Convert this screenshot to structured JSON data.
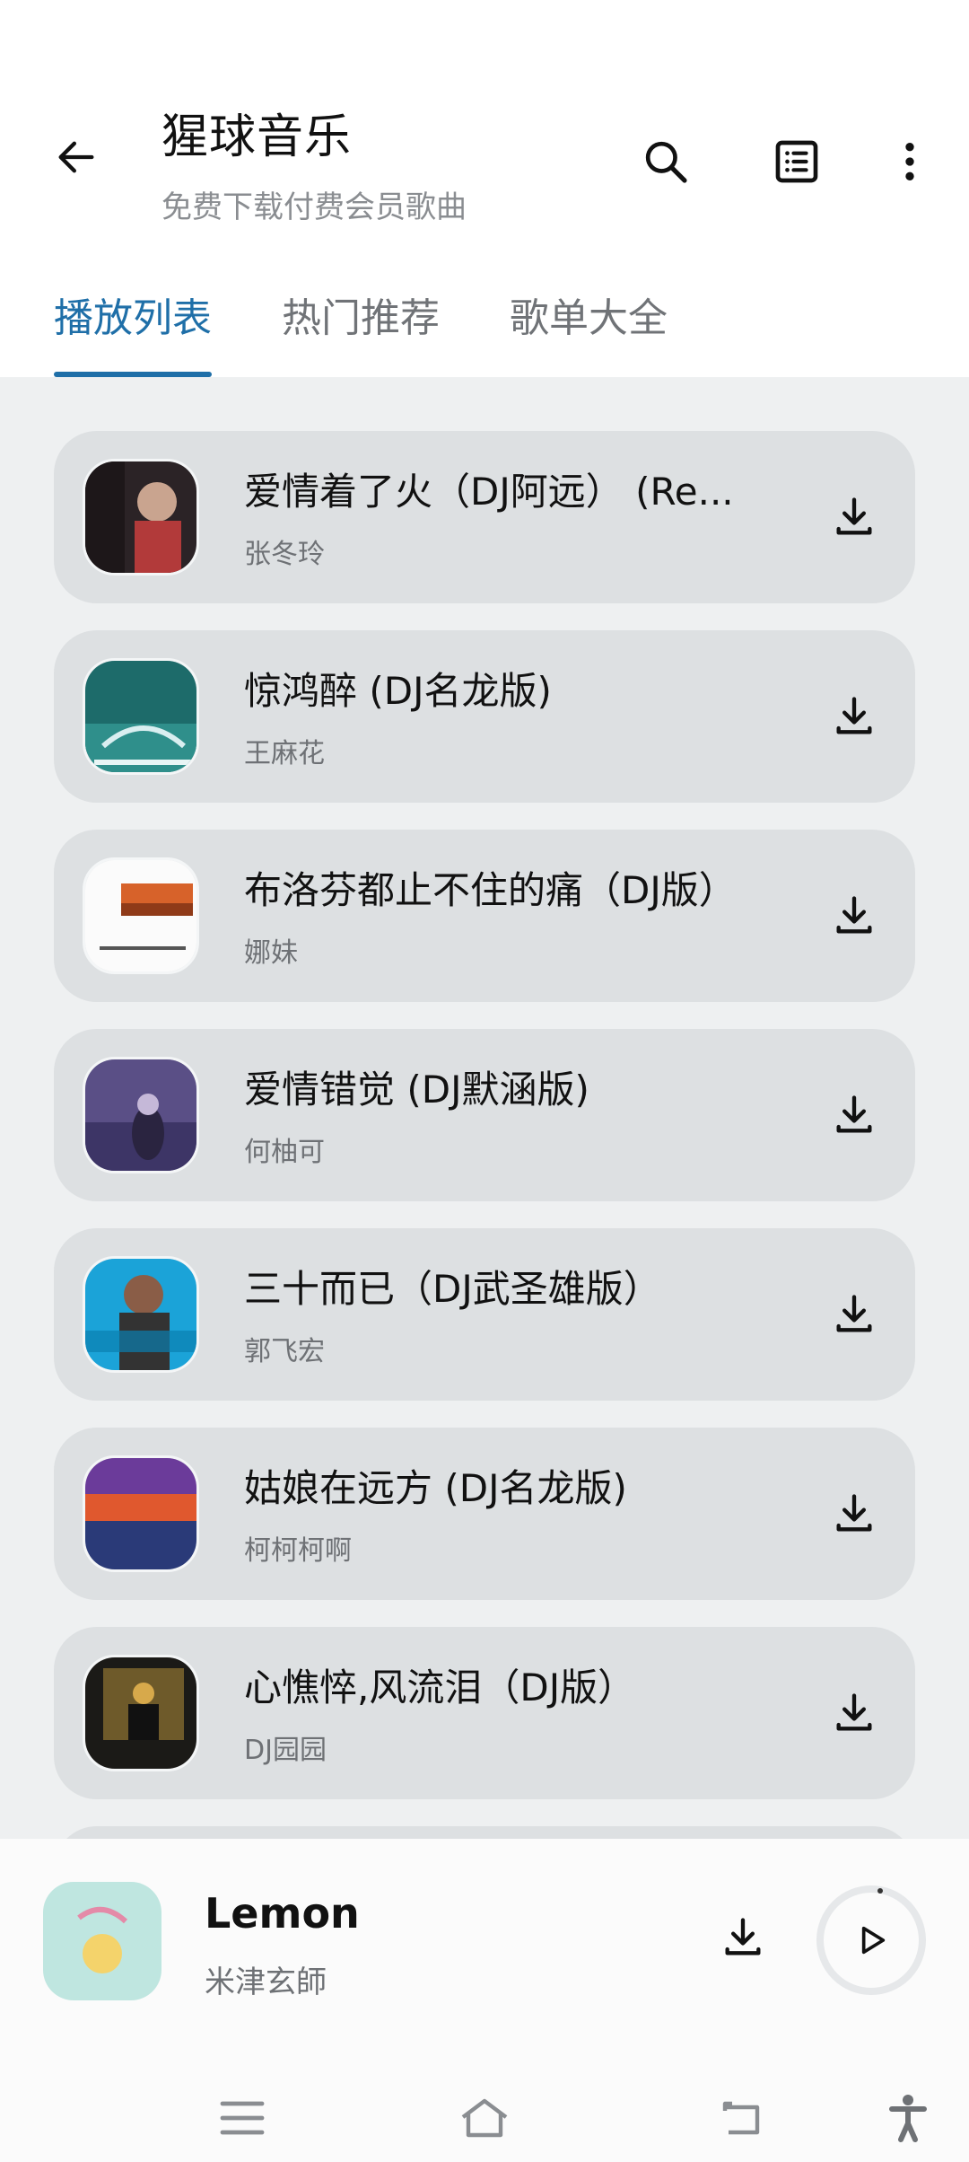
{
  "header": {
    "title": "猩球音乐",
    "subtitle": "免费下载付费会员歌曲",
    "icons": [
      "arrow-left-icon",
      "search-icon",
      "list-icon",
      "more-vertical-icon"
    ]
  },
  "tabs": [
    {
      "label": "播放列表",
      "active": true
    },
    {
      "label": "热门推荐",
      "active": false
    },
    {
      "label": "歌单大全",
      "active": false
    }
  ],
  "songs": [
    {
      "title": "爱情着了火（DJ阿远） (Re...",
      "artist": "张冬玲"
    },
    {
      "title": "惊鸿醉 (DJ名龙版)",
      "artist": "王麻花"
    },
    {
      "title": "布洛芬都止不住的痛（DJ版）",
      "artist": "娜妹"
    },
    {
      "title": "爱情错觉 (DJ默涵版)",
      "artist": "何柚可"
    },
    {
      "title": "三十而已（DJ武圣雄版）",
      "artist": "郭飞宏"
    },
    {
      "title": "姑娘在远方 (DJ名龙版)",
      "artist": "柯柯柯啊"
    },
    {
      "title": "心憔悴,风流泪（DJ版）",
      "artist": "DJ园园"
    }
  ],
  "now_playing": {
    "title": "Lemon",
    "artist": "米津玄師"
  },
  "colors": {
    "accent": "#1f6fa8",
    "card": "#dde0e2",
    "background": "#eef0f1"
  }
}
